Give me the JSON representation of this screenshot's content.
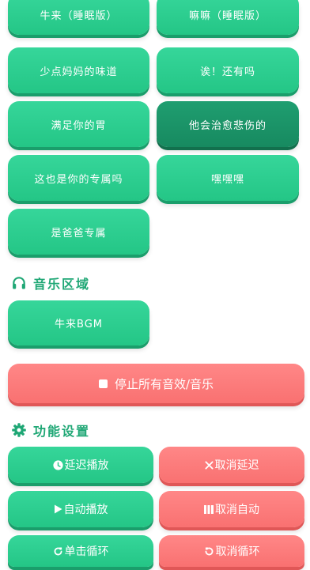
{
  "sounds": [
    {
      "label": "牛来（睡眠版）",
      "active": false
    },
    {
      "label": "嘛嘛（睡眠版）",
      "active": false
    },
    {
      "label": "少点妈妈的味道",
      "active": false
    },
    {
      "label": "诶！还有吗",
      "active": false
    },
    {
      "label": "满足你的胃",
      "active": false
    },
    {
      "label": "他会治愈悲伤的",
      "active": true
    },
    {
      "label": "这也是你的专属吗",
      "active": false
    },
    {
      "label": "嘿嘿嘿",
      "active": false
    },
    {
      "label": "是爸爸专属",
      "active": false
    }
  ],
  "music_section": {
    "title": "音乐区域",
    "icon": "headphones-icon",
    "bgm_label": "牛来BGM"
  },
  "stop_all": {
    "label": "停止所有音效/音乐",
    "icon": "stop-icon"
  },
  "settings_section": {
    "title": "功能设置",
    "icon": "gear-icon",
    "buttons": {
      "delay_play": "延迟播放",
      "cancel_delay": "取消延迟",
      "auto_play": "自动播放",
      "cancel_auto": "取消自动",
      "single_loop": "单击循环",
      "cancel_loop": "取消循环"
    }
  },
  "colors": {
    "green": "#27c98a",
    "dark_green": "#1a9168",
    "red": "#fb7a7a",
    "title_green": "#1fa775"
  }
}
